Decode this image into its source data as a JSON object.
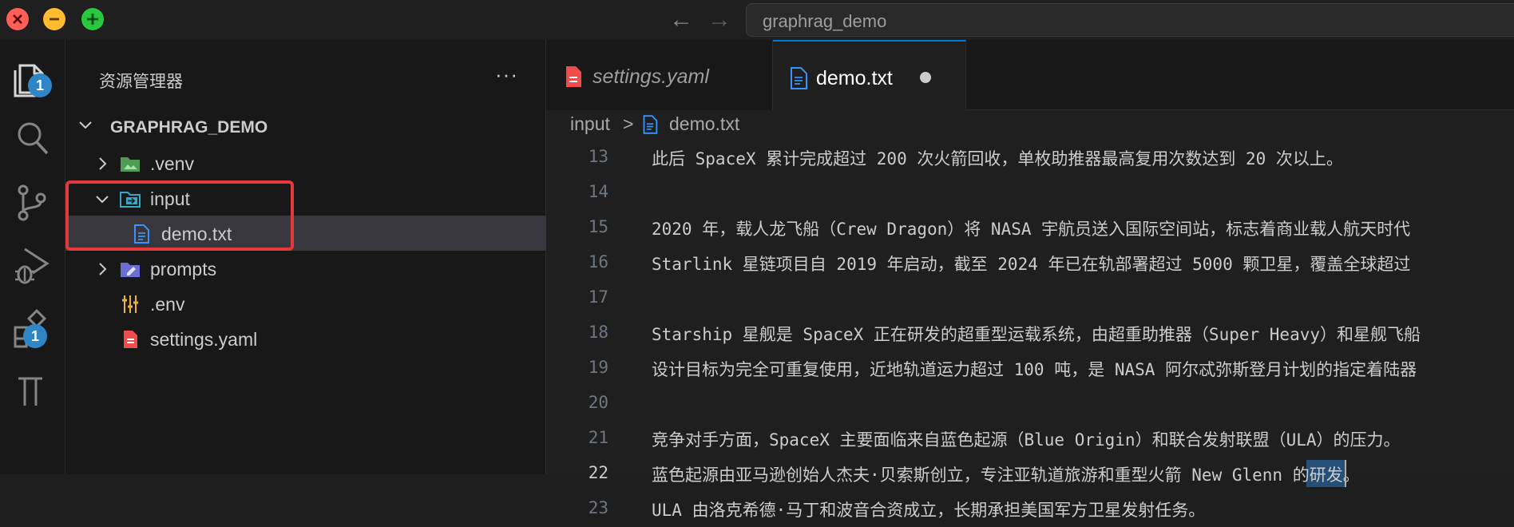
{
  "window": {
    "controls": [
      "close",
      "minimize",
      "zoom"
    ],
    "search_text": "graphrag_demo"
  },
  "activity_bar": {
    "items": [
      {
        "icon": "files-icon",
        "badge": "1"
      },
      {
        "icon": "search-icon",
        "badge": ""
      },
      {
        "icon": "source-control-icon",
        "badge": ""
      },
      {
        "icon": "run-debug-icon",
        "badge": ""
      },
      {
        "icon": "extensions-icon",
        "badge": "1"
      },
      {
        "icon": "testing-icon",
        "badge": ""
      }
    ]
  },
  "explorer": {
    "title": "资源管理器",
    "more": "···",
    "root": "GRAPHRAG_DEMO",
    "items": [
      {
        "label": ".venv",
        "type": "folder",
        "icon": "venv-folder-icon"
      },
      {
        "label": "input",
        "type": "folder-open",
        "icon": "input-folder-icon"
      },
      {
        "label": "demo.txt",
        "type": "file",
        "icon": "text-file-icon"
      },
      {
        "label": "prompts",
        "type": "folder",
        "icon": "prompts-folder-icon"
      },
      {
        "label": ".env",
        "type": "file",
        "icon": "env-file-icon"
      },
      {
        "label": "settings.yaml",
        "type": "file",
        "icon": "yaml-file-icon"
      }
    ],
    "highlight_color": "#e5383b"
  },
  "editor": {
    "tabs": [
      {
        "label": "settings.yaml",
        "icon": "yaml-file-icon",
        "active": false
      },
      {
        "label": "demo.txt",
        "icon": "text-file-icon",
        "active": true,
        "dirty": true
      }
    ],
    "breadcrumb": {
      "folder": "input",
      "separator": ">",
      "file": "demo.txt"
    },
    "lines": [
      {
        "n": "13",
        "text": "此后 SpaceX 累计完成超过 200 次火箭回收，单枚助推器最高复用次数达到 20 次以上。"
      },
      {
        "n": "14",
        "text": ""
      },
      {
        "n": "15",
        "text": "2020 年，载人龙飞船（Crew Dragon）将 NASA 宇航员送入国际空间站，标志着商业载人航天时代"
      },
      {
        "n": "16",
        "text": "Starlink 星链项目自 2019 年启动，截至 2024 年已在轨部署超过 5000 颗卫星，覆盖全球超过"
      },
      {
        "n": "17",
        "text": ""
      },
      {
        "n": "18",
        "text": "Starship 星舰是 SpaceX 正在研发的超重型运载系统，由超重助推器（Super Heavy）和星舰飞船"
      },
      {
        "n": "19",
        "text": "设计目标为完全可重复使用，近地轨道运力超过 100 吨，是 NASA 阿尔忒弥斯登月计划的指定着陆器"
      },
      {
        "n": "20",
        "text": ""
      },
      {
        "n": "21",
        "text": "竞争对手方面，SpaceX 主要面临来自蓝色起源（Blue Origin）和联合发射联盟（ULA）的压力。"
      },
      {
        "n": "22",
        "text": "蓝色起源由亚马逊创始人杰夫·贝索斯创立，专注亚轨道旅游和重型火箭 New Glenn 的研发。",
        "active": true
      },
      {
        "n": "23",
        "text": "ULA 由洛克希德·马丁和波音合资成立，长期承担美国军方卫星发射任务。"
      }
    ]
  },
  "colors": {
    "accent": "#0078d4",
    "badge": "#2f86c6",
    "yaml_icon": "#f14c4c",
    "text_icon": "#3794ff"
  }
}
